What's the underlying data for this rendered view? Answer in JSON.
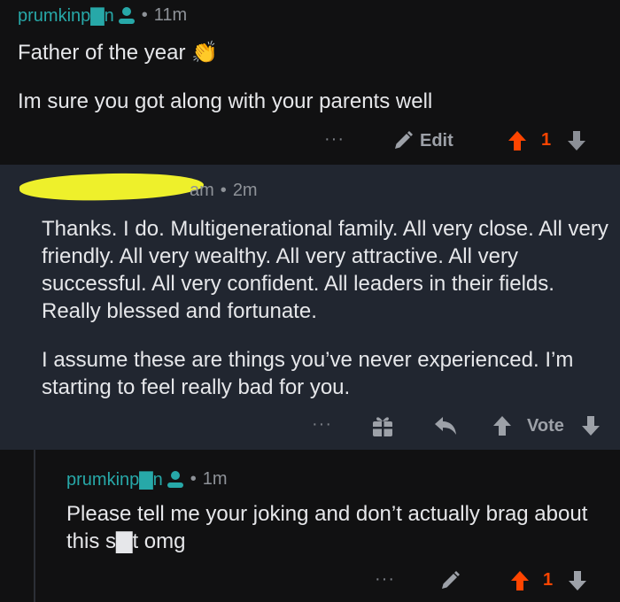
{
  "comment1": {
    "username": "prumkinp▇n",
    "time": "11m",
    "title_line": "Father of the year",
    "emoji": "👏",
    "body": "Im sure you got along with your parents well",
    "more": "···",
    "edit_label": "Edit",
    "score": "1"
  },
  "comment2": {
    "username_visible": "am",
    "time": "2m",
    "paragraph1": "Thanks. I do. Multigenerational family. All very close. All very friendly. All very wealthy. All very attractive. All very successful. All very confident. All leaders in their fields. Really blessed and fortunate.",
    "paragraph2": "I assume these are things you’ve never experienced. I’m starting to feel really bad for you.",
    "more": "···",
    "vote_label": "Vote"
  },
  "comment3": {
    "username": "prumkinp▇n",
    "time": "1m",
    "body": "Please tell me your joking and don’t actually brag about this s▇t omg",
    "more": "···",
    "score": "1"
  },
  "colors": {
    "username": "#27a8a8",
    "upvote_active": "#ff4500",
    "redaction": "#eef02b",
    "reply_background": "#212630"
  }
}
